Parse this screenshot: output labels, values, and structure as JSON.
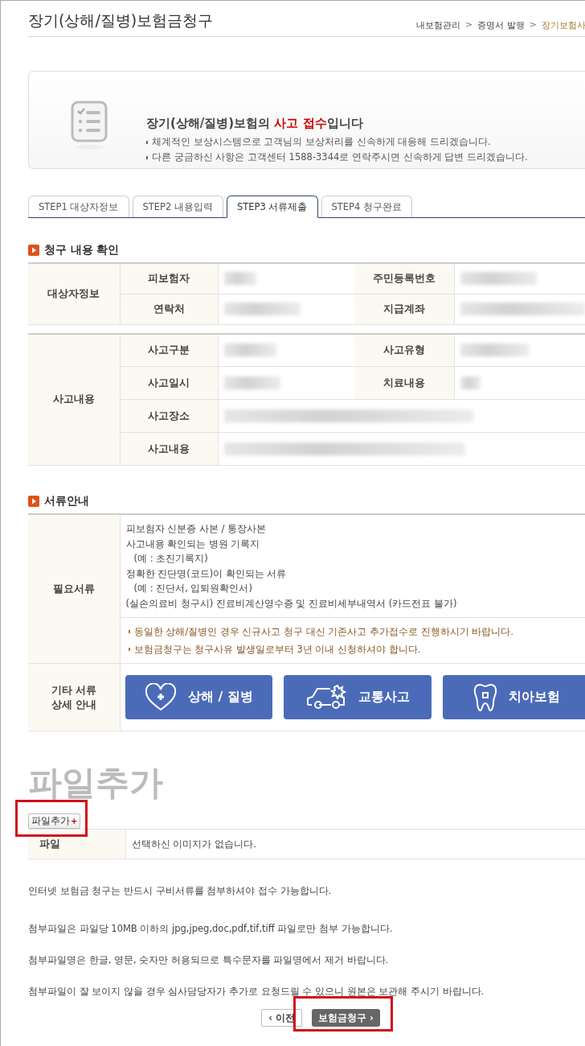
{
  "page_title": "장기(상해/질병)보험금청구",
  "breadcrumb": [
    {
      "label": "내보험관리",
      "current": false
    },
    {
      "label": "증명서 발행",
      "current": false
    },
    {
      "label": "장기보험사",
      "current": true
    }
  ],
  "breadcrumb_separator": ">",
  "intro": {
    "heading_before": "장기(상해/질병)보험의 ",
    "heading_highlight": "사고 접수",
    "heading_after": "입니다",
    "lines": [
      "체계적인 보상시스템으로 고객님의 보상처리를 신속하게 대응해 드리겠습니다.",
      "다른 궁금하신 사항은 고객센터 1588-3344로 연락주시면 신속하게 답변 드리겠습니다."
    ]
  },
  "tabs": [
    {
      "label": "STEP1 대상자정보",
      "selected": false
    },
    {
      "label": "STEP2 내용입력",
      "selected": false
    },
    {
      "label": "STEP3 서류제출",
      "selected": true
    },
    {
      "label": "STEP4 청구완료",
      "selected": false
    }
  ],
  "claim_section": {
    "title": "청구 내용 확인",
    "groups": [
      {
        "label": "대상자정보",
        "rows": [
          [
            {
              "label": "피보험자",
              "redacted": true
            },
            {
              "label": "주민등록번호",
              "redacted": true
            }
          ],
          [
            {
              "label": "연락처",
              "redacted": true
            },
            {
              "label": "지급계좌",
              "redacted": true
            }
          ]
        ]
      },
      {
        "label": "사고내용",
        "rows": [
          [
            {
              "label": "사고구분",
              "redacted": true
            },
            {
              "label": "사고유형",
              "redacted": true
            }
          ],
          [
            {
              "label": "사고일시",
              "redacted": true
            },
            {
              "label": "치료내용",
              "redacted": true
            }
          ],
          [
            {
              "label": "사고장소",
              "redacted": true
            }
          ],
          [
            {
              "label": "사고내용",
              "redacted": true
            }
          ]
        ]
      }
    ]
  },
  "documents_section": {
    "title": "서류안내",
    "required_label": "필요서류",
    "required_items": [
      {
        "kind": "item",
        "text": "피보험자 신분증 사본 / 통장사본"
      },
      {
        "kind": "item",
        "text": "사고내용 확인되는 병원 기록지"
      },
      {
        "kind": "example",
        "text": "(예 : 초진기록지)"
      },
      {
        "kind": "item",
        "text": "정확한 진단명(코드)이 확인되는 서류"
      },
      {
        "kind": "example",
        "text": "(예 : 진단서, 입퇴원확인서)"
      },
      {
        "kind": "item",
        "text": "(실손의료비 청구시) 진료비계산영수증 및 진료비세부내역서 (카드전표 불가)"
      }
    ],
    "notes": [
      "동일한 상해/질병인 경우 신규사고 청구 대신 기존사고 추가접수로 진행하시기 바랍니다.",
      "보험금청구는 청구사유 발생일로부터 3년 이내 신청하셔야 합니다."
    ],
    "other_label": [
      "기타 서류",
      "상세 안내"
    ],
    "guide_buttons": [
      {
        "kind": "injury",
        "label": "상해 / 질병"
      },
      {
        "kind": "traffic",
        "label": "교통사고"
      },
      {
        "kind": "dental",
        "label": "치아보험"
      }
    ]
  },
  "file_section": {
    "title": "파일추가",
    "add_button": "파일추가",
    "add_mark": "+",
    "add_highlighted": true,
    "file_label": "파일",
    "file_value": "선택하신 이미지가 없습니다."
  },
  "notices": [
    "인터넷 보험금 청구는 반드시 구비서류를 첨부하셔야 접수 가능합니다.",
    "첨부파일은 파일당 10MB 이하의 jpg,jpeg,doc,pdf,tif,tiff 파일로만 첨부 가능합니다.",
    "첨부파일명은 한글, 영문, 숫자만 허용되므로 특수문자를 파일명에서 제거 바랍니다.",
    "첨부파일이 잘 보이지 않을 경우 심사담당자가 추가로 요청드릴 수 있으니 원본은 보관해 주시기 바랍니다."
  ],
  "footer_buttons": {
    "prev": "‹ 이전",
    "submit": "보험금청구 ›",
    "submit_highlighted": true
  }
}
